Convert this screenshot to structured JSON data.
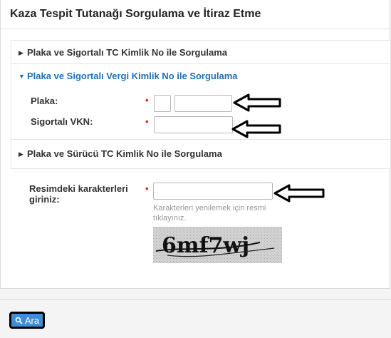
{
  "panel": {
    "title": "Kaza Tespit Tutanağı Sorgulama ve İtiraz Etme"
  },
  "sections": [
    {
      "label": "Plaka ve Sigortalı TC Kimlik No ile Sorgulama",
      "expanded": false
    },
    {
      "label": "Plaka ve Sigortalı Vergi Kimlik No ile Sorgulama",
      "expanded": true
    },
    {
      "label": "Plaka ve Sürücü TC Kimlik No ile Sorgulama",
      "expanded": false
    }
  ],
  "form": {
    "plate_label": "Plaka:",
    "plate_city_value": "",
    "plate_number_value": "",
    "vkn_label": "Sigortalı VKN:",
    "vkn_value": "",
    "captcha_label": "Resimdeki karakterleri giriniz:",
    "captcha_value": "",
    "captcha_hint": "Karakterleri yenilemek için resmi tıklayınız.",
    "captcha_text": "6mf7wj",
    "required_mark": "•"
  },
  "actions": {
    "search_label": "Ara"
  },
  "icons": {
    "collapsed": "triangle-right-icon",
    "expanded": "triangle-down-icon",
    "search": "magnifier-icon",
    "annotation": "arrow-left-icon"
  },
  "colors": {
    "accent": "#1f6fb5",
    "required": "#d9261c",
    "button": "#3d8fd8"
  }
}
